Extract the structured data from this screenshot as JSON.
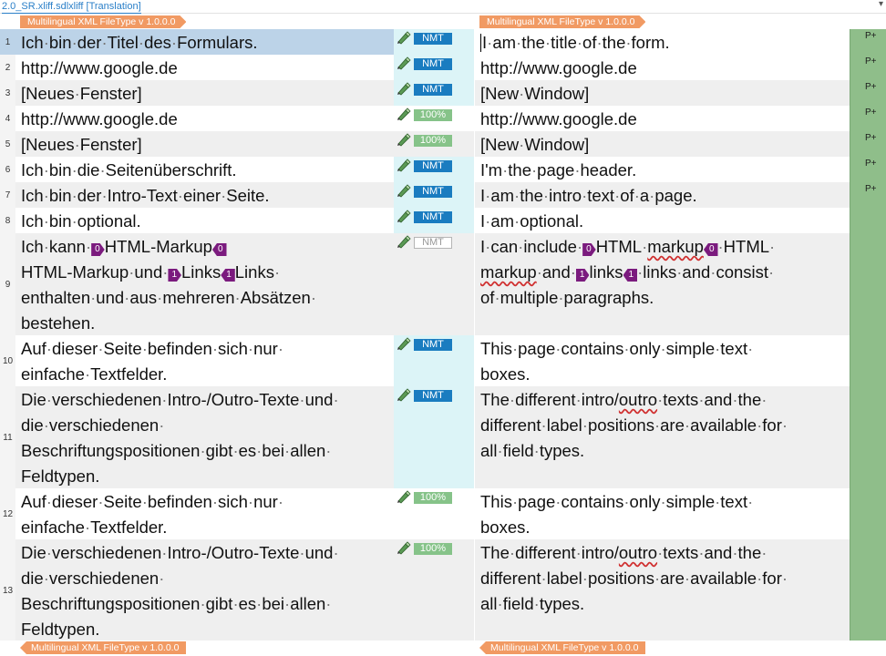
{
  "document_tab": "2.0_SR.xliff.sdlxliff [Translation]",
  "header_tag": "Multilingual XML FileType v 1.0.0.0",
  "footer_tag": "Multilingual XML FileType v 1.0.0.0",
  "colors": {
    "selected_row": "#bcd3e8",
    "alt_row": "#efefef",
    "mid_highlight": "#dcf4f7",
    "nmt_badge": "#1a7cc0",
    "match_badge": "#86c389",
    "status_col": "#8fbe8a",
    "inline_tag": "#7b1b7e",
    "file_tag": "#f19a63"
  },
  "rows": [
    {
      "num": "1",
      "status": "P+",
      "origin": "NMT",
      "bg": "selected",
      "source": [
        [
          "Ich bin der Titel des Formulars."
        ]
      ],
      "target": [
        [
          "I am the title of the form."
        ]
      ]
    },
    {
      "num": "2",
      "status": "P+",
      "origin": "NMT",
      "bg": "white",
      "source": [
        [
          "http://www.google.de"
        ]
      ],
      "target": [
        [
          "http://www.google.de"
        ]
      ]
    },
    {
      "num": "3",
      "status": "P+",
      "origin": "NMT",
      "bg": "gray",
      "source": [
        [
          "[Neues Fenster]"
        ]
      ],
      "target": [
        [
          "[New Window]"
        ]
      ]
    },
    {
      "num": "4",
      "status": "P+",
      "origin": "100%",
      "bg": "white",
      "source": [
        [
          "http://www.google.de"
        ]
      ],
      "target": [
        [
          "http://www.google.de"
        ]
      ]
    },
    {
      "num": "5",
      "status": "P+",
      "origin": "100%",
      "bg": "gray",
      "source": [
        [
          "[Neues Fenster]"
        ]
      ],
      "target": [
        [
          "[New Window]"
        ]
      ]
    },
    {
      "num": "6",
      "status": "P+",
      "origin": "NMT",
      "bg": "white",
      "source": [
        [
          "Ich bin die Seitenüberschrift."
        ]
      ],
      "target": [
        [
          "I'm the page header."
        ]
      ]
    },
    {
      "num": "7",
      "status": "P+",
      "origin": "NMT",
      "bg": "gray",
      "source": [
        [
          "Ich bin der Intro-Text einer Seite."
        ]
      ],
      "target": [
        [
          "I am the intro text of a page."
        ]
      ]
    },
    {
      "num": "8",
      "status": "",
      "origin": "NMT",
      "bg": "white",
      "source": [
        [
          "Ich bin optional."
        ]
      ],
      "target": [
        [
          "I am optional."
        ]
      ]
    },
    {
      "num": "9",
      "status": "",
      "origin": "NMT",
      "origin_style": "empty",
      "bg": "gray",
      "source": [
        [
          "Ich kann ",
          {
            "tag": "0",
            "kind": "o"
          },
          "HTML-Markup",
          {
            "tag": "0",
            "kind": "c"
          }
        ],
        [
          "HTML-Markup und ",
          {
            "tag": "1",
            "kind": "o"
          },
          "Links",
          {
            "tag": "1",
            "kind": "c"
          },
          "Links "
        ],
        [
          "enthalten und aus mehreren Absätzen "
        ],
        [
          "bestehen."
        ]
      ],
      "target": [
        [
          "I can include ",
          {
            "tag": "0",
            "kind": "o"
          },
          "HTML ",
          {
            "sq": "markup"
          },
          {
            "tag": "0",
            "kind": "c"
          },
          " HTML "
        ],
        [
          {
            "sq": "markup"
          },
          " and ",
          {
            "tag": "1",
            "kind": "o"
          },
          "links",
          {
            "tag": "1",
            "kind": "c"
          },
          " links and consist "
        ],
        [
          "of multiple paragraphs."
        ]
      ]
    },
    {
      "num": "10",
      "status": "",
      "origin": "NMT",
      "bg": "white",
      "source": [
        [
          "Auf dieser Seite befinden sich nur "
        ],
        [
          "einfache Textfelder."
        ]
      ],
      "target": [
        [
          "This page contains only simple text "
        ],
        [
          "boxes."
        ]
      ]
    },
    {
      "num": "11",
      "status": "",
      "origin": "NMT",
      "bg": "gray",
      "source": [
        [
          "Die verschiedenen Intro-/Outro-Texte und "
        ],
        [
          "die verschiedenen "
        ],
        [
          "Beschriftungspositionen gibt es bei allen "
        ],
        [
          "Feldtypen."
        ]
      ],
      "target": [
        [
          "The different intro/",
          {
            "sq": "outro"
          },
          " texts and the "
        ],
        [
          "different label positions are available for "
        ],
        [
          "all field types."
        ]
      ]
    },
    {
      "num": "12",
      "status": "",
      "origin": "100%",
      "bg": "white",
      "source": [
        [
          "Auf dieser Seite befinden sich nur "
        ],
        [
          "einfache Textfelder."
        ]
      ],
      "target": [
        [
          "This page contains only simple text "
        ],
        [
          "boxes."
        ]
      ]
    },
    {
      "num": "13",
      "status": "",
      "origin": "100%",
      "bg": "gray",
      "source": [
        [
          "Die verschiedenen Intro-/Outro-Texte und "
        ],
        [
          "die verschiedenen "
        ],
        [
          "Beschriftungspositionen gibt es bei allen "
        ],
        [
          "Feldtypen."
        ]
      ],
      "target": [
        [
          "The different intro/",
          {
            "sq": "outro"
          },
          " texts and the "
        ],
        [
          "different label positions are available for "
        ],
        [
          "all field types."
        ]
      ]
    }
  ]
}
